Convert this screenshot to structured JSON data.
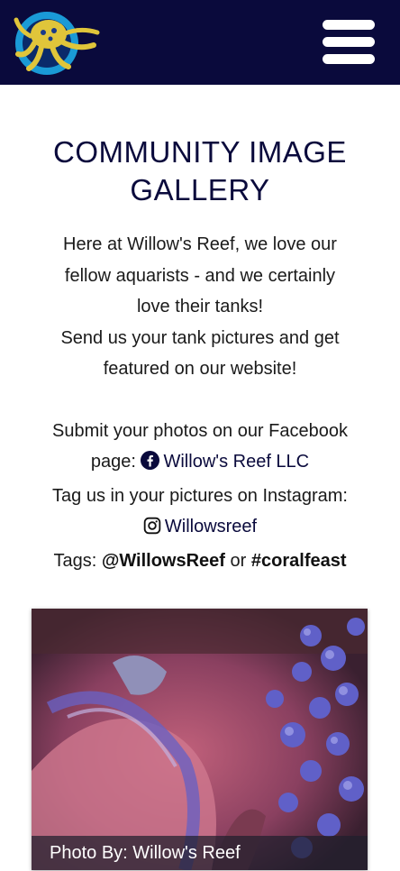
{
  "header": {
    "logo_icon": "octopus-logo-icon",
    "menu_icon": "hamburger-menu-icon",
    "bg_color": "#0a0a3c"
  },
  "main": {
    "title_line1": "COMMUNITY IMAGE",
    "title_line2": "GALLERY",
    "intro_line1": "Here at Willow's Reef, we love our",
    "intro_line2": "fellow aquarists - and we certainly",
    "intro_line3": "love their tanks!",
    "intro_line4": "Send us your tank pictures and get",
    "intro_line5": "featured on our website!",
    "facebook_line1": "Submit your photos on our Facebook",
    "facebook_prefix": "page:",
    "facebook_link": "Willow's Reef LLC",
    "instagram_line": "Tag us in your pictures on Instagram:",
    "instagram_link": "Willowsreef",
    "tags_prefix": "Tags:",
    "tag1": "@WillowsReef",
    "tags_or": "or",
    "tag2": "#coralfeast"
  },
  "gallery": {
    "caption": "Photo By: Willow's Reef"
  }
}
